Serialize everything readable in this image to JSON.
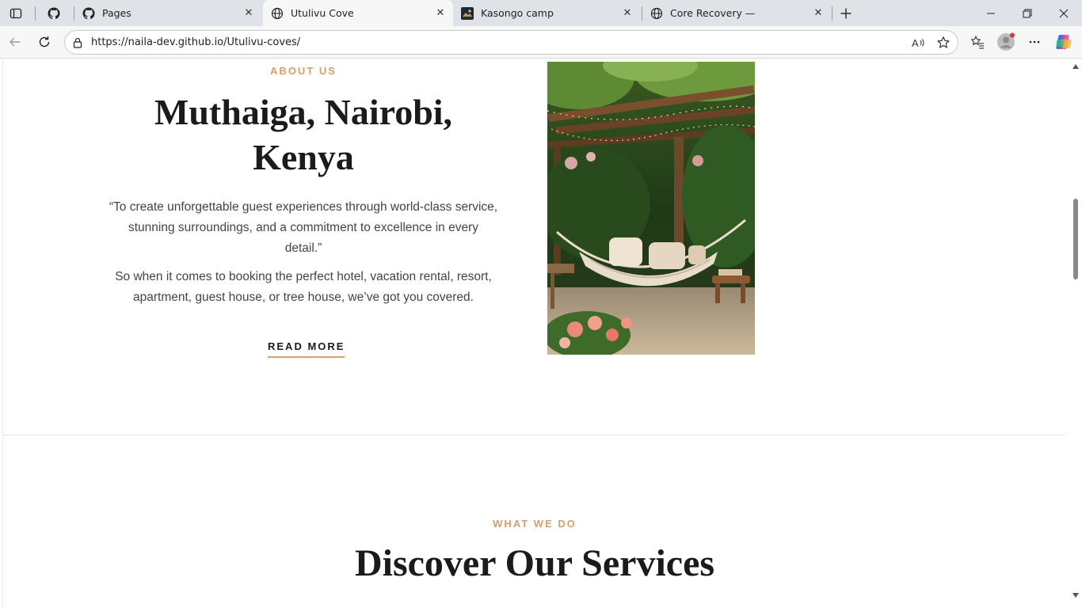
{
  "browser": {
    "tabs": [
      {
        "title": "",
        "favicon": "github-icon"
      },
      {
        "title": "Pages",
        "favicon": "github-icon"
      },
      {
        "title": "Utulivu Cove",
        "favicon": "globe-icon",
        "active": true
      },
      {
        "title": "Kasongo camp",
        "favicon": "site-thumbnail-icon"
      },
      {
        "title": "Core Recovery —",
        "favicon": "globe-icon"
      }
    ],
    "address": {
      "url": "https://naila-dev.github.io/Utulivu-coves/"
    },
    "colors": {
      "tab_strip": "#dfe3e8",
      "toolbar": "#f7f7f7",
      "accent": "#d7a06a"
    }
  },
  "page": {
    "about": {
      "eyebrow": "ABOUT US",
      "title_line1": "Muthaiga, Nairobi,",
      "title_line2": "Kenya",
      "quote_line1": "“To create unforgettable guest experiences through world-class service,",
      "quote_line2": "stunning surroundings, and a commitment to excellence in every",
      "quote_line3": "detail.”",
      "body_line1": "So when it comes to booking the perfect hotel, vacation rental, resort,",
      "body_line2": "apartment, guest house, or tree house, we’ve got you covered.",
      "cta": "READ MORE",
      "image": "garden-hammock-photo"
    },
    "services": {
      "eyebrow": "WHAT WE DO",
      "title": "Discover Our Services"
    }
  }
}
